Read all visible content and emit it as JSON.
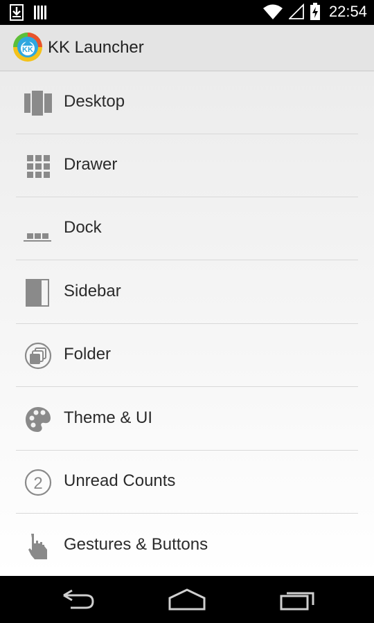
{
  "status_bar": {
    "time": "22:54",
    "icons": [
      "download-icon",
      "barcode-icon",
      "wifi-icon",
      "signal-icon",
      "battery-charging-icon"
    ]
  },
  "app_bar": {
    "title": "KK Launcher",
    "logo_icon": "kk-launcher-logo-icon"
  },
  "menu": {
    "items": [
      {
        "label": "Desktop",
        "icon": "desktop-panels-icon"
      },
      {
        "label": "Drawer",
        "icon": "grid-icon"
      },
      {
        "label": "Dock",
        "icon": "dock-icon"
      },
      {
        "label": "Sidebar",
        "icon": "sidebar-icon"
      },
      {
        "label": "Folder",
        "icon": "folder-icon"
      },
      {
        "label": "Theme & UI",
        "icon": "palette-icon"
      },
      {
        "label": "Unread Counts",
        "icon": "unread-count-icon"
      },
      {
        "label": "Gestures & Buttons",
        "icon": "gesture-hand-icon"
      }
    ]
  },
  "nav_bar": {
    "buttons": [
      "back",
      "home",
      "recents"
    ]
  },
  "colors": {
    "status_bar": "#000000",
    "app_bar": "#e4e4e4",
    "icon_gray": "#8a8a8a",
    "text": "#2b2b2b"
  }
}
